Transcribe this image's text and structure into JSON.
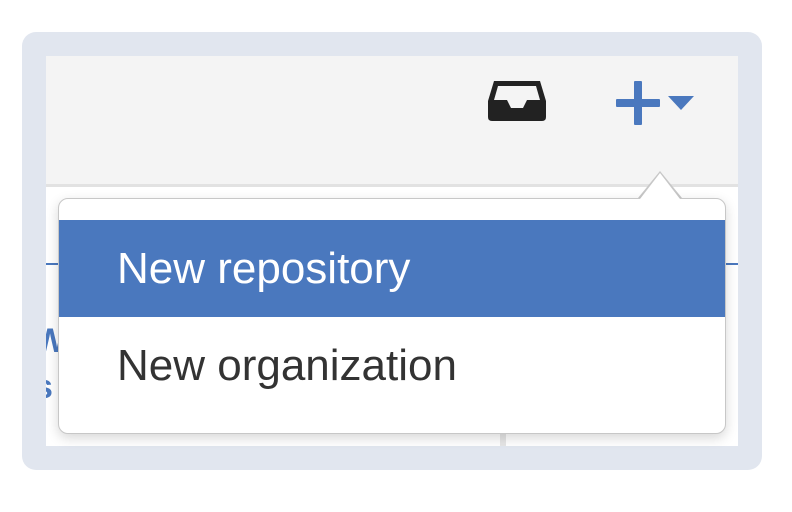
{
  "header": {
    "inbox_icon": "inbox-tray-icon",
    "create_icon": "plus-icon",
    "create_caret_icon": "caret-down-icon",
    "accent_color": "#4a78be"
  },
  "background_fragment": {
    "text": "…"
  },
  "dropdown": {
    "items": [
      {
        "label": "New repository",
        "highlighted": true
      },
      {
        "label": "New organization",
        "highlighted": false
      }
    ]
  }
}
